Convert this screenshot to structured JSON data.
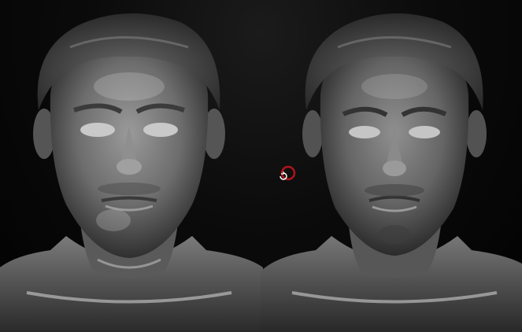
{
  "viewport": {
    "background": "#0b0b0b",
    "material_color": "#7a7a7a",
    "highlight_color": "#d9d9d9",
    "cursor_color": "#b0141c"
  },
  "models": [
    {
      "name": "sculpt-before",
      "icon": "head-sculpt-icon"
    },
    {
      "name": "sculpt-after",
      "icon": "head-sculpt-icon"
    }
  ],
  "cursor": {
    "icon": "rotate-brush-cursor-icon"
  }
}
